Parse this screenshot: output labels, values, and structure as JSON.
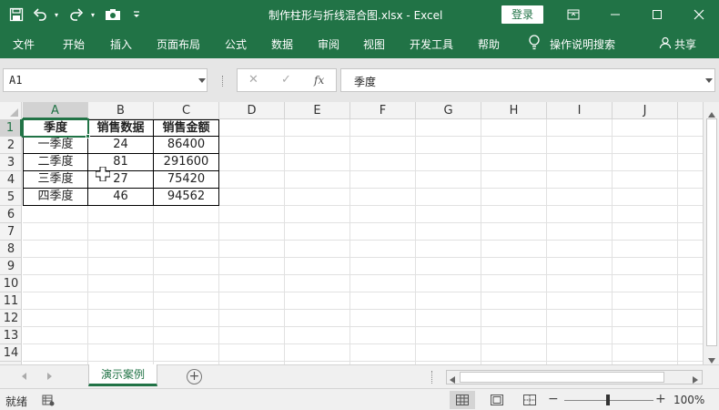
{
  "window": {
    "title": "制作柱形与折线混合图.xlsx - Excel",
    "login_label": "登录",
    "brand_color": "#217346"
  },
  "quick_access": [
    "save-icon",
    "undo-icon",
    "redo-icon",
    "camera-icon",
    "customize-icon"
  ],
  "ribbon": {
    "tabs": [
      "文件",
      "开始",
      "插入",
      "页面布局",
      "公式",
      "数据",
      "审阅",
      "视图",
      "开发工具",
      "帮助"
    ],
    "tell_me": "操作说明搜索",
    "share": "共享"
  },
  "formula_bar": {
    "name_box": "A1",
    "fx_label": "fx",
    "content": "季度"
  },
  "sheet": {
    "columns": [
      "A",
      "B",
      "C",
      "D",
      "E",
      "F",
      "G",
      "H",
      "I",
      "J"
    ],
    "rows": [
      "1",
      "2",
      "3",
      "4",
      "5",
      "6",
      "7",
      "8",
      "9",
      "10",
      "11",
      "12",
      "13",
      "14"
    ],
    "selected_cell": "A1",
    "table": {
      "headers": [
        "季度",
        "销售数据",
        "销售金额"
      ],
      "data": [
        [
          "一季度",
          "24",
          "86400"
        ],
        [
          "二季度",
          "81",
          "291600"
        ],
        [
          "三季度",
          "27",
          "75420"
        ],
        [
          "四季度",
          "46",
          "94562"
        ]
      ]
    }
  },
  "tabs_bar": {
    "sheet_name": "演示案例",
    "add_label": "+"
  },
  "status": {
    "ready": "就绪",
    "zoom": "100%"
  }
}
